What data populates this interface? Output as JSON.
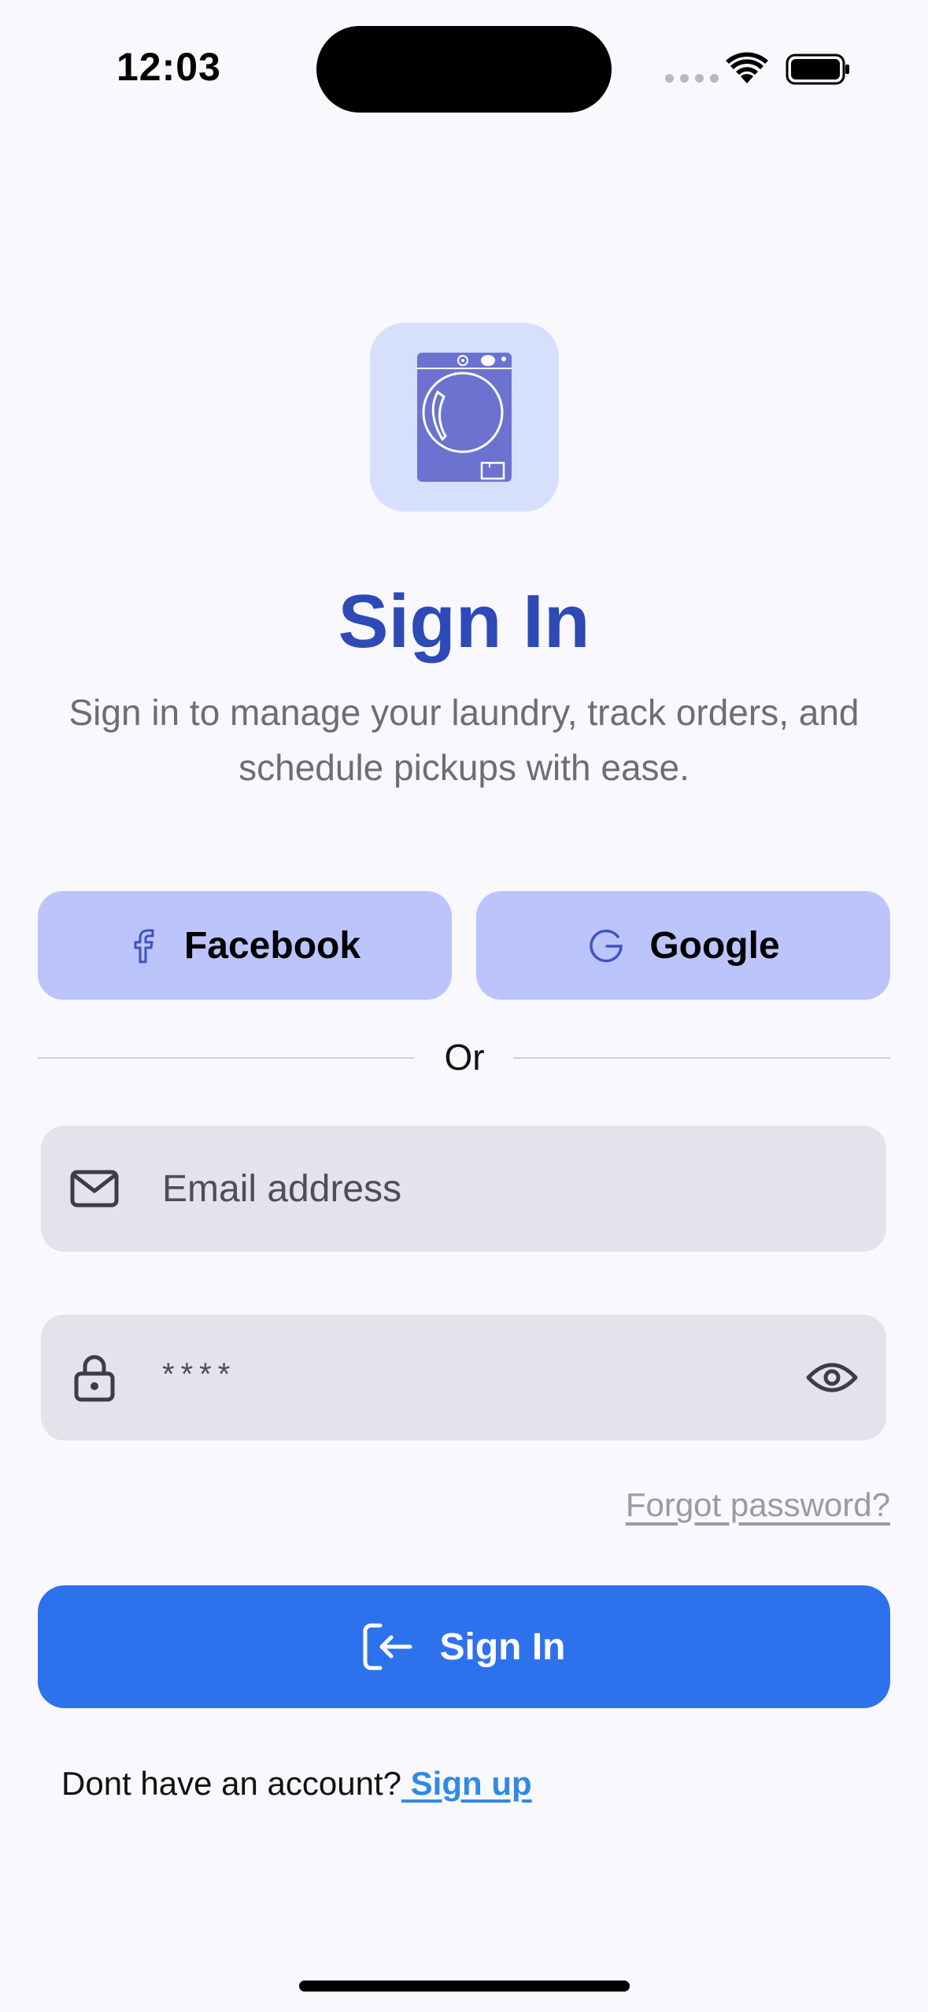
{
  "status_bar": {
    "time": "12:03",
    "icons": [
      "cellular-signal-icon",
      "wifi-icon",
      "battery-icon"
    ]
  },
  "logo": {
    "icon": "washing-machine-icon",
    "bg_color": "#d6e0fd",
    "icon_color": "#6b72cf"
  },
  "title": "Sign In",
  "subtitle": "Sign in to manage your laundry, track orders, and schedule pickups with ease.",
  "social": {
    "facebook_label": "Facebook",
    "google_label": "Google",
    "button_color": "#bcc4fc"
  },
  "divider_text": "Or",
  "form": {
    "email_placeholder": "Email address",
    "password_value": "****",
    "forgot_label": "Forgot password?"
  },
  "signin_button": {
    "label": "Sign In",
    "color": "#2e71ec"
  },
  "signup": {
    "prompt": "Dont have an account?",
    "link_label": " Sign up"
  },
  "colors": {
    "title": "#2d4ab6",
    "background": "#f9f8fd",
    "link": "#2e8ae8"
  }
}
